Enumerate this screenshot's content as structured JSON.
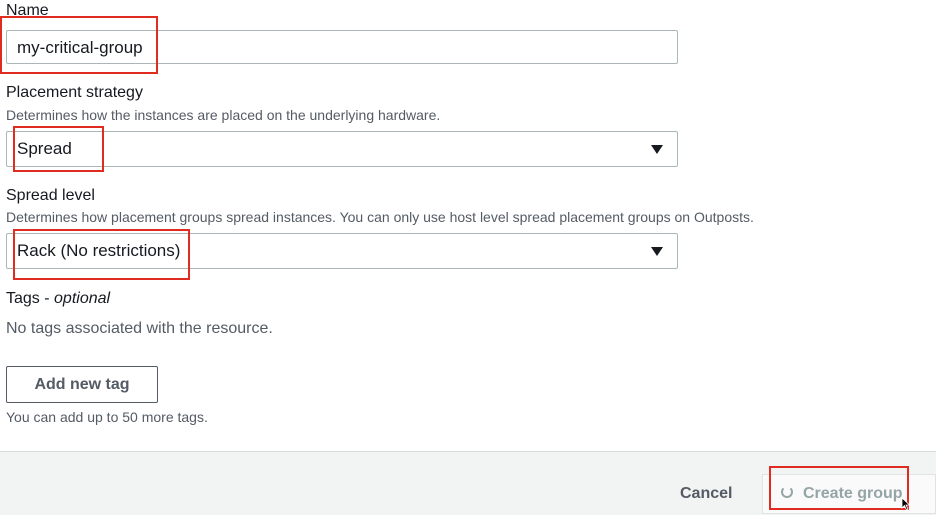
{
  "name_field": {
    "label": "Name",
    "value": "my-critical-group"
  },
  "placement": {
    "label": "Placement strategy",
    "description": "Determines how the instances are placed on the underlying hardware.",
    "selected": "Spread"
  },
  "spread_level": {
    "label": "Spread level",
    "description": "Determines how placement groups spread instances. You can only use host level spread placement groups on Outposts.",
    "selected": "Rack (No restrictions)"
  },
  "tags": {
    "label": "Tags - ",
    "label_optional": "optional",
    "empty_text": "No tags associated with the resource.",
    "add_button": "Add new tag",
    "limit_text": "You can add up to 50 more tags."
  },
  "footer": {
    "cancel": "Cancel",
    "create": "Create group"
  },
  "colors": {
    "highlight": "#e02b20",
    "footer_bg": "#f2f3f3"
  }
}
